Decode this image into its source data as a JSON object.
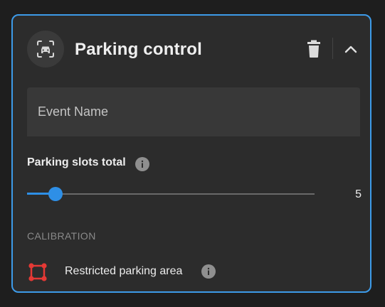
{
  "card": {
    "title": "Parking control",
    "icons": {
      "avatar": "car-scan-icon",
      "delete": "trash-icon",
      "collapse": "chevron-up-icon"
    },
    "colors": {
      "accent": "#2e8fe6",
      "border": "#3d9be9",
      "danger": "#e53935"
    }
  },
  "event_name": {
    "placeholder": "Event Name",
    "value": ""
  },
  "parking_slots": {
    "label": "Parking slots total",
    "value": "5",
    "slider_fraction": 0.1,
    "info_icon": "info-icon"
  },
  "calibration": {
    "section_label": "CALIBRATION",
    "items": [
      {
        "label": "Restricted parking area",
        "icon": "polygon-area-icon",
        "info_icon": "info-icon"
      }
    ]
  }
}
